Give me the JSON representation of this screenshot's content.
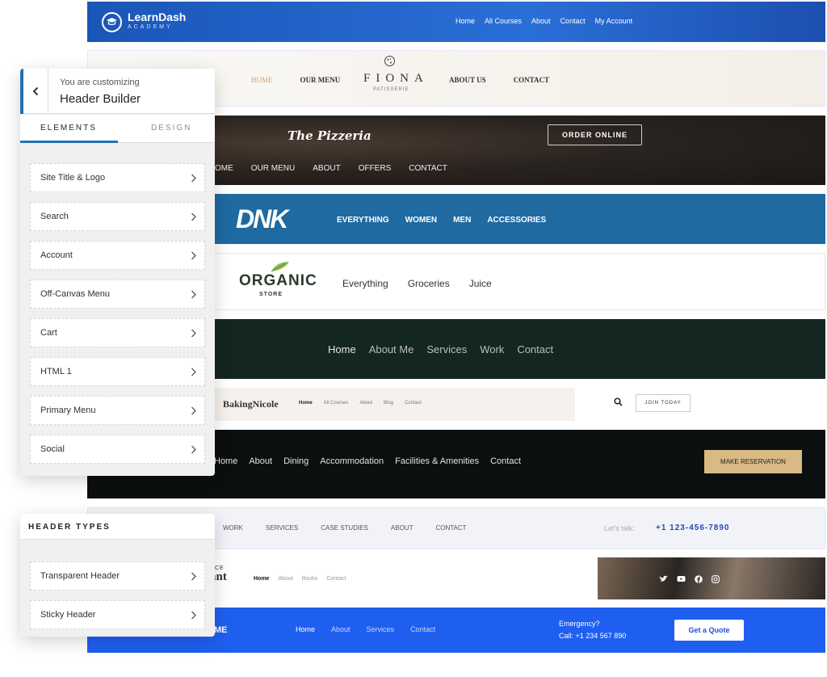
{
  "learndash": {
    "brand": "LearnDash",
    "sub": "ACADEMY",
    "nav": [
      "Home",
      "All Courses",
      "About",
      "Contact",
      "My Account"
    ]
  },
  "fiona": {
    "nav_left": [
      "HOME",
      "OUR MENU"
    ],
    "logo": "FIONA",
    "logo_sub": "PATISSERIE",
    "nav_right": [
      "ABOUT US",
      "CONTACT"
    ]
  },
  "pizzeria": {
    "logo": "The Pizzeria",
    "order": "ORDER ONLINE",
    "nav": [
      "OME",
      "OUR MENU",
      "ABOUT",
      "OFFERS",
      "CONTACT"
    ]
  },
  "dnk": {
    "logo": "DNK",
    "nav": [
      "EVERYTHING",
      "WOMEN",
      "MEN",
      "ACCESSORIES"
    ]
  },
  "organic": {
    "logo": "ORGANIC",
    "logo_sub": "STORE",
    "nav": [
      "Everything",
      "Groceries",
      "Juice"
    ]
  },
  "portfolio": {
    "nav": [
      "Home",
      "About Me",
      "Services",
      "Work",
      "Contact"
    ]
  },
  "baking": {
    "logo": "BakingNicole",
    "nav": [
      "Home",
      "All Courses",
      "About",
      "Blog",
      "Contact"
    ],
    "join": "JOIN TODAY"
  },
  "hotel": {
    "nav": [
      "Home",
      "About",
      "Dining",
      "Accommodation",
      "Facilities & Amenities",
      "Contact"
    ],
    "cta": "MAKE RESERVATION"
  },
  "agency": {
    "nav": [
      "WORK",
      "SERVICES",
      "CASE STUDIES",
      "ABOUT",
      "CONTACT"
    ],
    "talk": "Let's talk:",
    "phone": "+1 123-456-7890"
  },
  "author": {
    "logo_top": "CE",
    "logo": "ant",
    "nav": [
      "Home",
      "About",
      "Books",
      "Contact"
    ]
  },
  "blue": {
    "logo": "ME",
    "nav": [
      "Home",
      "About",
      "Services",
      "Contact"
    ],
    "emergency": "Emergency?",
    "call": "Call: +1 234 567 890",
    "quote": "Get a Quote"
  },
  "customizer": {
    "customizing": "You are customizing",
    "title": "Header Builder",
    "tab_elements": "ELEMENTS",
    "tab_design": "DESIGN",
    "elements": [
      "Site Title & Logo",
      "Search",
      "Account",
      "Off-Canvas Menu",
      "Cart",
      "HTML 1",
      "Primary Menu",
      "Social"
    ]
  },
  "header_types": {
    "title": "HEADER TYPES",
    "items": [
      "Transparent Header",
      "Sticky Header"
    ]
  }
}
